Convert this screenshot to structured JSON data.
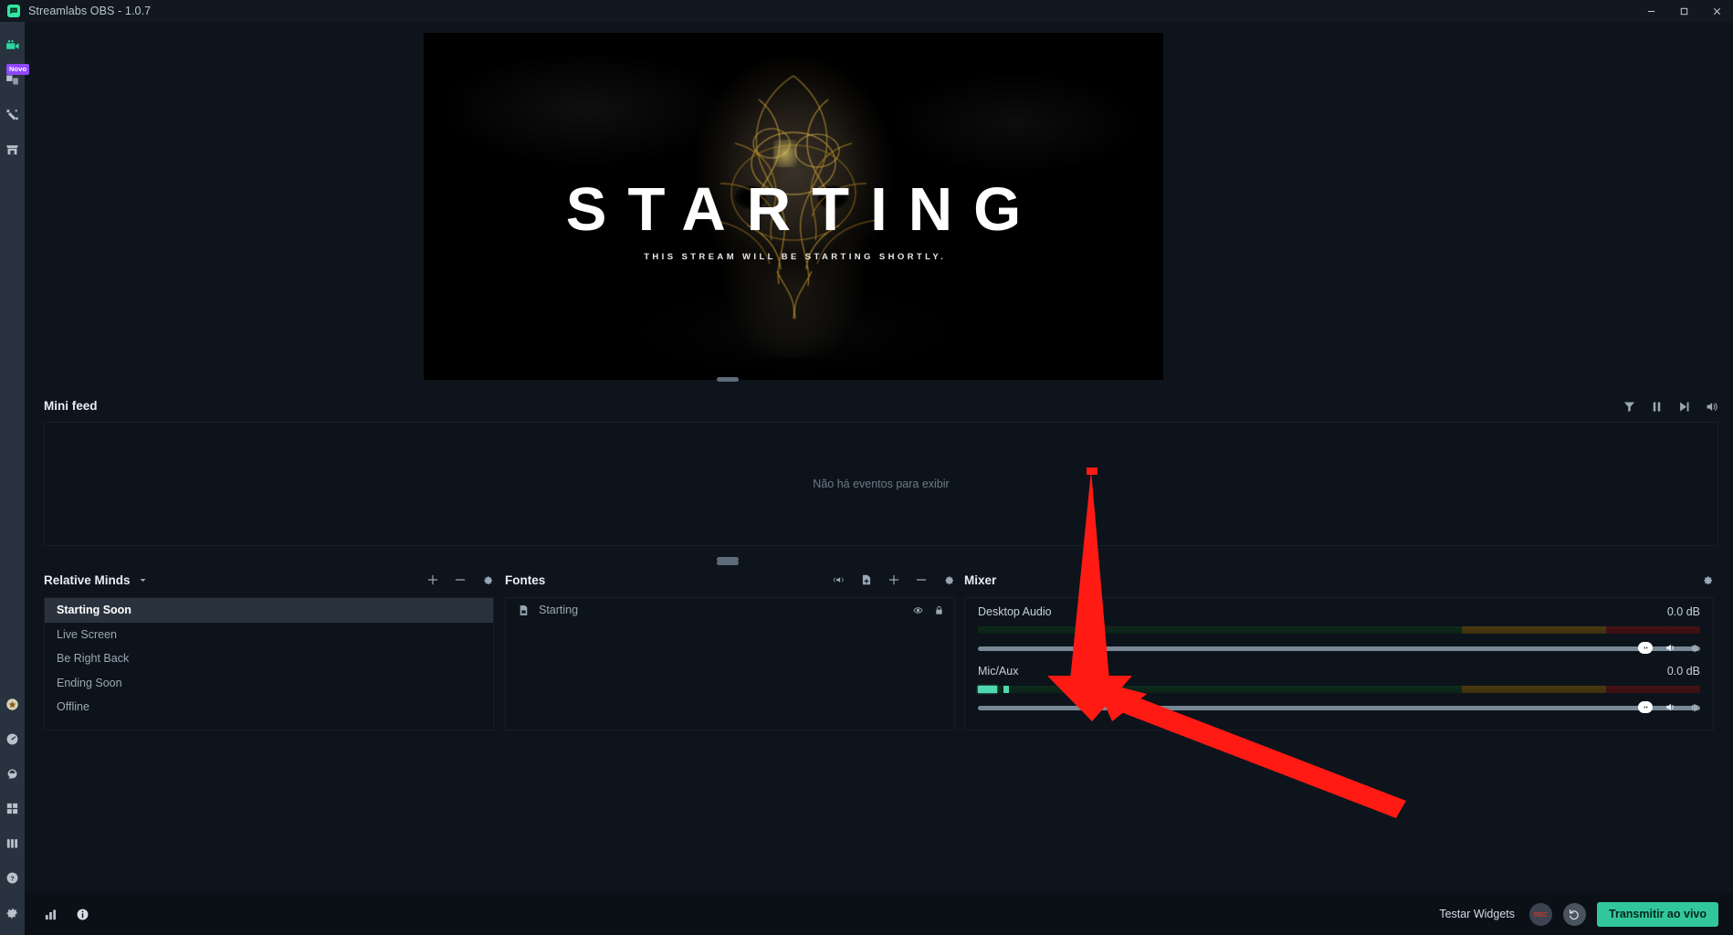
{
  "titlebar": {
    "title": "Streamlabs OBS - 1.0.7",
    "logo_icon": "chat-bot-icon",
    "minimize_label": "minimize-icon",
    "maximize_label": "maximize-icon",
    "close_label": "close-icon"
  },
  "leftnav": {
    "top_items": [
      {
        "icon": "video-camera-icon",
        "name": "editor",
        "accent": "#2fd8a0",
        "badge": ""
      },
      {
        "icon": "themes-layers-icon",
        "name": "themes",
        "accent": "#b7c2cd",
        "badge": "Novo"
      },
      {
        "icon": "magic-wand-icon",
        "name": "alert-box",
        "accent": "#b7c2cd",
        "badge": ""
      },
      {
        "icon": "store-icon",
        "name": "store",
        "accent": "#b7c2cd",
        "badge": ""
      }
    ],
    "bottom_items": [
      {
        "icon": "prime-star-icon",
        "name": "prime",
        "accent": "#c8911f",
        "badge": ""
      },
      {
        "icon": "dashboard-clock-icon",
        "name": "dashboard",
        "accent": "#b7c2cd",
        "badge": ""
      },
      {
        "icon": "cloudbot-icon",
        "name": "cloudbot",
        "accent": "#b7c2cd",
        "badge": ""
      },
      {
        "icon": "apps-grid-icon",
        "name": "apps",
        "accent": "#b7c2cd",
        "badge": ""
      },
      {
        "icon": "bar-chart-icon",
        "name": "analytics",
        "accent": "#b7c2cd",
        "badge": ""
      },
      {
        "icon": "help-question-icon",
        "name": "help",
        "accent": "#b7c2cd",
        "badge": ""
      },
      {
        "icon": "gear-icon",
        "name": "settings",
        "accent": "#b7c2cd",
        "badge": ""
      }
    ]
  },
  "preview": {
    "scene_heading": "STARTING",
    "scene_subheading": "THIS STREAM WILL BE STARTING SHORTLY."
  },
  "minifeed": {
    "title": "Mini feed",
    "empty_message": "Não há eventos para exibir",
    "icons": [
      {
        "name": "filter-funnel-icon"
      },
      {
        "name": "pause-icon"
      },
      {
        "name": "skip-next-icon"
      },
      {
        "name": "volume-icon"
      }
    ]
  },
  "scenes": {
    "title": "Relative Minds",
    "caret_icon": "chevron-down-icon",
    "header_icons": [
      {
        "name": "add-scene-icon",
        "glyph": "plus"
      },
      {
        "name": "remove-scene-icon",
        "glyph": "minus"
      },
      {
        "name": "scene-settings-icon",
        "glyph": "gear"
      }
    ],
    "items": [
      {
        "label": "Starting Soon",
        "active": true
      },
      {
        "label": "Live Screen",
        "active": false
      },
      {
        "label": "Be Right Back",
        "active": false
      },
      {
        "label": "Ending Soon",
        "active": false
      },
      {
        "label": "Offline",
        "active": false
      }
    ]
  },
  "sources": {
    "title": "Fontes",
    "header_icons": [
      {
        "name": "audio-source-icon",
        "glyph": "speaker-wave"
      },
      {
        "name": "add-file-source-icon",
        "glyph": "file-plus"
      },
      {
        "name": "add-source-icon",
        "glyph": "plus"
      },
      {
        "name": "remove-source-icon",
        "glyph": "minus"
      },
      {
        "name": "source-settings-icon",
        "glyph": "gear"
      }
    ],
    "items": [
      {
        "label": "Starting",
        "type_icon": "image-file-icon",
        "visibility_icon": "eye-icon",
        "lock_icon": "lock-icon"
      }
    ]
  },
  "mixer": {
    "title": "Mixer",
    "settings_icon": "gear-icon",
    "channels": [
      {
        "name": "Desktop Audio",
        "db": "0.0 dB",
        "level_percent": 0,
        "slider_percent": 100,
        "knob_icon": "slider-handle-icon",
        "speaker_icon": "volume-icon",
        "gear_icon": "gear-icon"
      },
      {
        "name": "Mic/Aux",
        "db": "0.0 dB",
        "level_percent": 5,
        "slider_percent": 100,
        "knob_icon": "slider-handle-icon",
        "speaker_icon": "volume-icon",
        "gear_icon": "gear-icon"
      }
    ]
  },
  "statusbar": {
    "left_icons": [
      {
        "name": "performance-bars-icon"
      },
      {
        "name": "info-icon"
      }
    ],
    "test_widgets_label": "Testar Widgets",
    "rec_label": "REC",
    "replay_icon": "replay-buffer-icon",
    "go_live_label": "Transmitir ao vivo"
  },
  "colors": {
    "accent_green": "#31c79a",
    "nav_bg": "#28333f",
    "panel_bg": "#0d131a",
    "app_bg": "#0e141b",
    "annotation_red": "#ff1a14",
    "prime_gold": "#c8911f",
    "badge_purple": "#9147ff"
  }
}
